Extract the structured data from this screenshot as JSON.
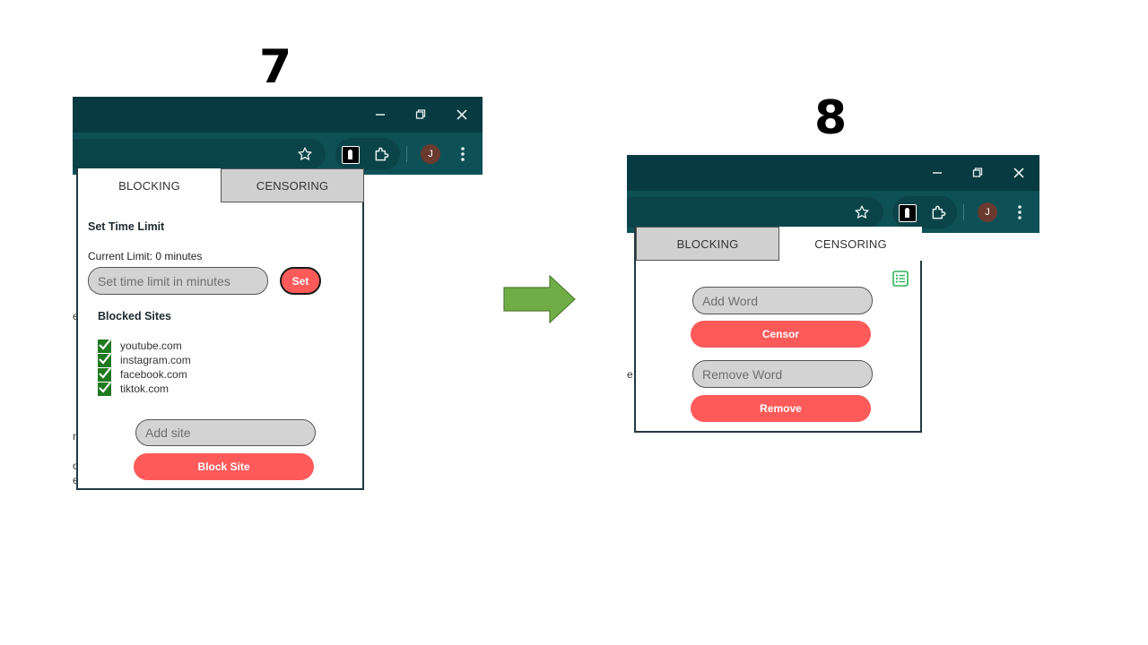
{
  "steps": {
    "left": "7",
    "right": "8"
  },
  "colors": {
    "titlebar": "#073a41",
    "toolbar": "#0d5157",
    "accent": "#ff5a5a",
    "check": "#1f7a1f",
    "arrow": "#70ad47"
  },
  "browser": {
    "window_buttons": [
      "minimize-icon",
      "restore-icon",
      "close-icon"
    ],
    "toolbar_icons": [
      "star-icon",
      "extension-logo-icon",
      "puzzle-icon",
      "avatar",
      "kebab-menu-icon"
    ],
    "avatar_letter": "J"
  },
  "popup_blocking": {
    "tabs": [
      "BLOCKING",
      "CENSORING"
    ],
    "active_tab": "BLOCKING",
    "time_limit": {
      "heading": "Set Time Limit",
      "current": "Current Limit: 0 minutes",
      "placeholder": "Set time limit in minutes",
      "button": "Set"
    },
    "blocked_sites": {
      "heading": "Blocked Sites",
      "items": [
        "youtube.com",
        "instagram.com",
        "facebook.com",
        "tiktok.com"
      ]
    },
    "add_site": {
      "placeholder": "Add site",
      "button": "Block Site"
    }
  },
  "popup_censoring": {
    "tabs": [
      "BLOCKING",
      "CENSORING"
    ],
    "active_tab": "CENSORING",
    "add_word": {
      "placeholder": "Add Word",
      "button": "Censor"
    },
    "remove_word": {
      "placeholder": "Remove Word",
      "button": "Remove"
    }
  },
  "page_fragments_left": [
    "e",
    "n",
    "o",
    "e"
  ],
  "page_fragments_right": [
    "e"
  ]
}
